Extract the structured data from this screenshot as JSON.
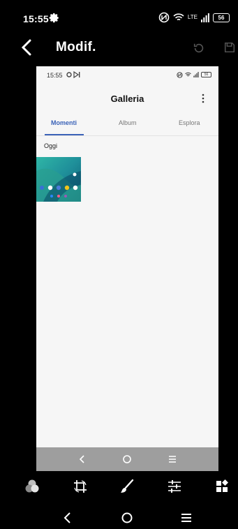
{
  "status_bar": {
    "time": "15:55",
    "battery": "56",
    "network": "LTE",
    "icons": [
      "settings-gear-icon",
      "nfc-icon",
      "wifi-icon",
      "signal-icon",
      "battery-icon"
    ]
  },
  "header": {
    "title": "Modif.",
    "icons": [
      "back-arrow-icon",
      "undo-icon",
      "save-icon"
    ]
  },
  "preview": {
    "status_time": "15:55",
    "status_battery": "56",
    "app_title": "Galleria",
    "tabs": [
      {
        "label": "Momenti",
        "active": true
      },
      {
        "label": "Album",
        "active": false
      },
      {
        "label": "Esplora",
        "active": false
      }
    ],
    "section_label": "Oggi",
    "accent_color": "#3b63b8",
    "nav_icons": [
      "back-icon",
      "home-icon",
      "recents-icon"
    ]
  },
  "toolbar": {
    "tools": [
      "filters-icon",
      "crop-rotate-icon",
      "brush-icon",
      "adjust-icon",
      "sticker-icon"
    ]
  },
  "system_nav": {
    "icons": [
      "back-icon",
      "home-icon",
      "recents-icon"
    ]
  }
}
